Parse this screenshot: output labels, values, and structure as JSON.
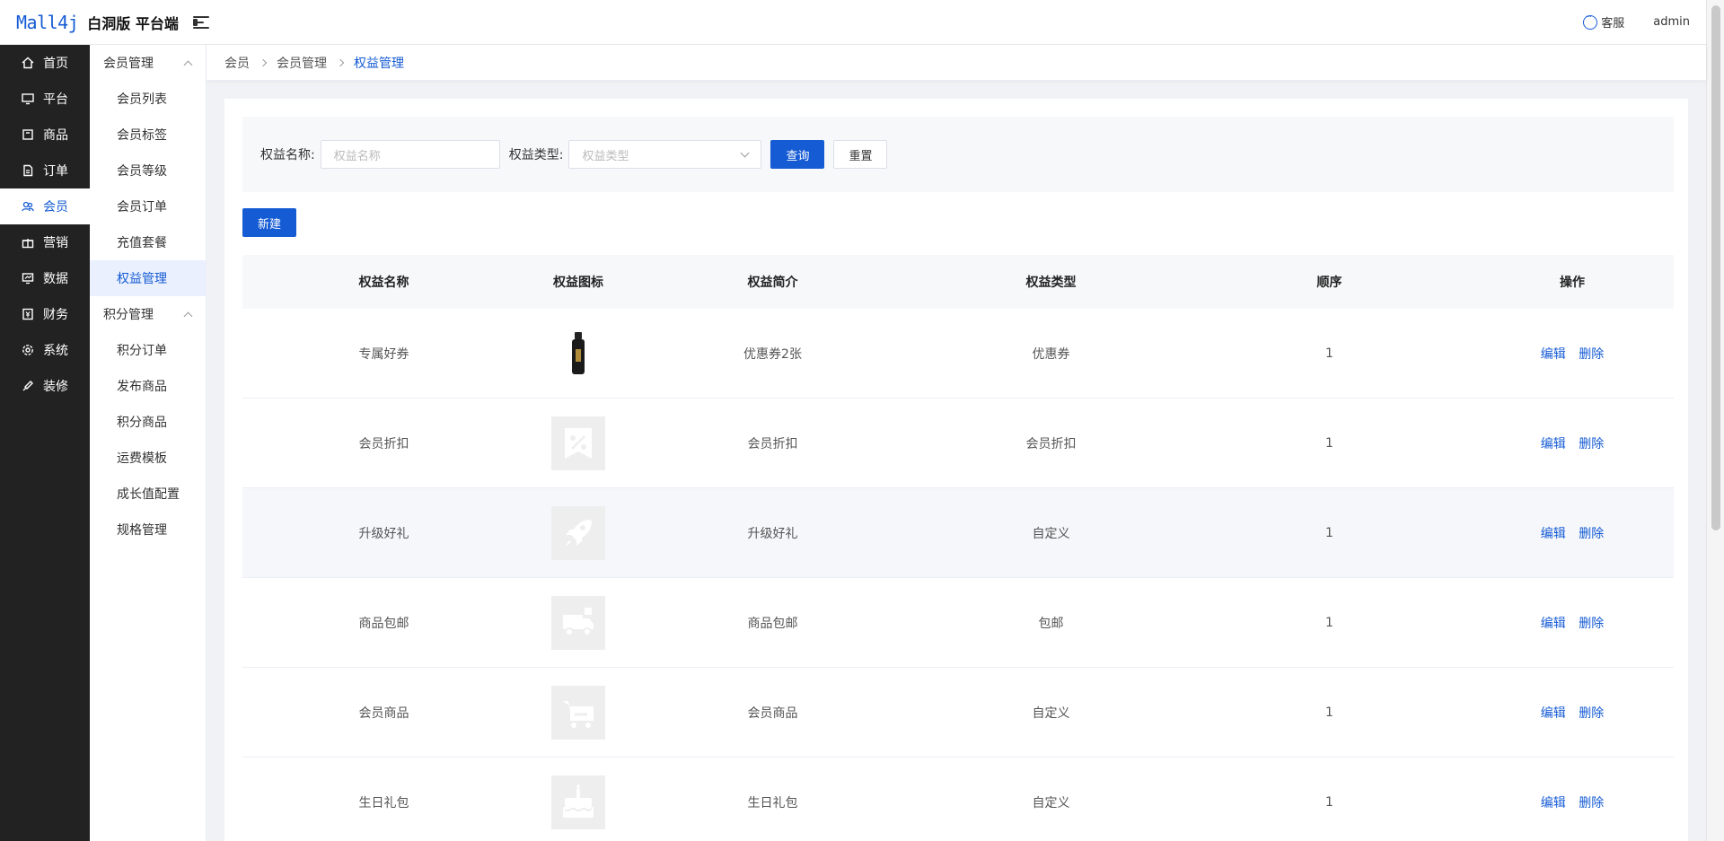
{
  "header": {
    "logo": "Mall4j",
    "title": "白洞版 平台端",
    "service_label": "客服",
    "user": "admin"
  },
  "leftnav": {
    "items": [
      {
        "label": "首页",
        "icon": "home-icon"
      },
      {
        "label": "平台",
        "icon": "monitor-icon"
      },
      {
        "label": "商品",
        "icon": "box-icon"
      },
      {
        "label": "订单",
        "icon": "document-icon"
      },
      {
        "label": "会员",
        "icon": "users-icon",
        "active": true
      },
      {
        "label": "营销",
        "icon": "gift-icon"
      },
      {
        "label": "数据",
        "icon": "chart-icon"
      },
      {
        "label": "财务",
        "icon": "finance-icon"
      },
      {
        "label": "系统",
        "icon": "gear-icon"
      },
      {
        "label": "装修",
        "icon": "brush-icon"
      }
    ]
  },
  "submenu": {
    "group1": "会员管理",
    "group1_items": [
      "会员列表",
      "会员标签",
      "会员等级",
      "会员订单",
      "充值套餐",
      "权益管理"
    ],
    "group2": "积分管理",
    "group2_items": [
      "积分订单",
      "发布商品",
      "积分商品",
      "运费模板",
      "成长值配置",
      "规格管理"
    ]
  },
  "breadcrumb": [
    "会员",
    "会员管理",
    "权益管理"
  ],
  "search": {
    "name_label": "权益名称:",
    "name_placeholder": "权益名称",
    "type_label": "权益类型:",
    "type_placeholder": "权益类型",
    "query_btn": "查询",
    "reset_btn": "重置"
  },
  "new_btn": "新建",
  "table": {
    "headers": [
      "权益名称",
      "权益图标",
      "权益简介",
      "权益类型",
      "顺序",
      "操作"
    ],
    "rows": [
      {
        "name": "专属好券",
        "icon": "product-photo",
        "intro": "优惠券2张",
        "type": "优惠券",
        "order": "1"
      },
      {
        "name": "会员折扣",
        "icon": "percent-icon",
        "intro": "会员折扣",
        "type": "会员折扣",
        "order": "1"
      },
      {
        "name": "升级好礼",
        "icon": "rocket-icon",
        "intro": "升级好礼",
        "type": "自定义",
        "order": "1"
      },
      {
        "name": "商品包邮",
        "icon": "truck-icon",
        "intro": "商品包邮",
        "type": "包邮",
        "order": "1"
      },
      {
        "name": "会员商品",
        "icon": "cart-icon",
        "intro": "会员商品",
        "type": "自定义",
        "order": "1"
      },
      {
        "name": "生日礼包",
        "icon": "cake-icon",
        "intro": "生日礼包",
        "type": "自定义",
        "order": "1"
      }
    ],
    "edit_label": "编辑",
    "delete_label": "删除"
  },
  "colors": {
    "primary": "#155bd4",
    "nav_bg": "#222222"
  }
}
